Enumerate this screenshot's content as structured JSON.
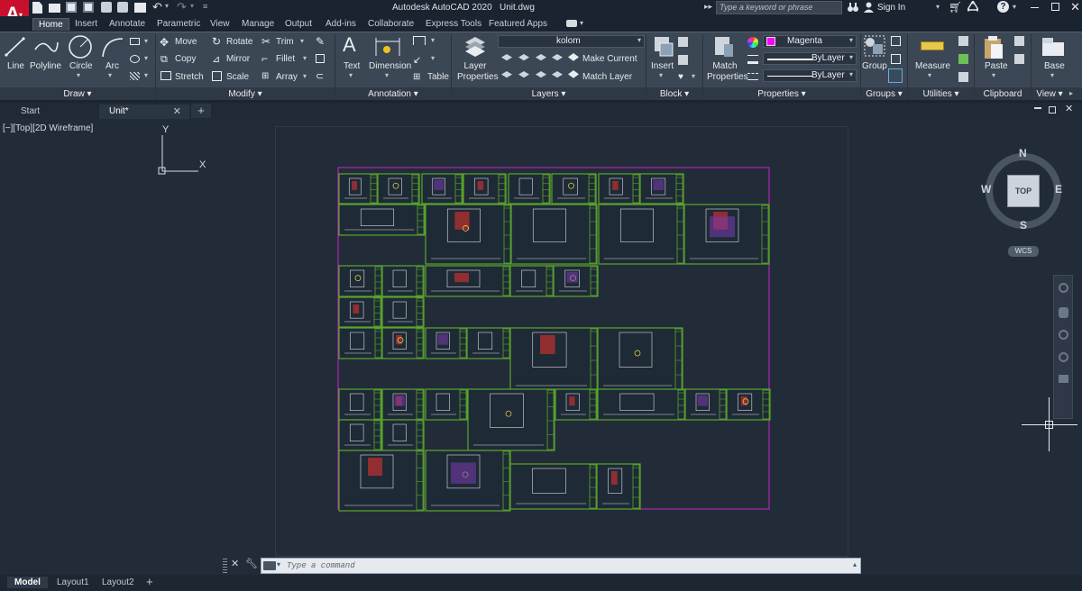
{
  "app": {
    "title": "Autodesk AutoCAD 2020",
    "file": "Unit.dwg",
    "logo_letter": "A",
    "search_placeholder": "Type a keyword or phrase",
    "signin": "Sign In"
  },
  "ribbon_tabs": [
    "Home",
    "Insert",
    "Annotate",
    "Parametric",
    "View",
    "Manage",
    "Output",
    "Add-ins",
    "Collaborate",
    "Express Tools",
    "Featured Apps"
  ],
  "draw": {
    "line": "Line",
    "polyline": "Polyline",
    "circle": "Circle",
    "arc": "Arc",
    "label": "Draw"
  },
  "modify": {
    "move": "Move",
    "rotate": "Rotate",
    "trim": "Trim",
    "copy": "Copy",
    "mirror": "Mirror",
    "fillet": "Fillet",
    "stretch": "Stretch",
    "scale": "Scale",
    "array": "Array",
    "label": "Modify"
  },
  "annotation": {
    "text": "Text",
    "dimension": "Dimension",
    "table": "Table",
    "label": "Annotation"
  },
  "layers": {
    "layer_properties": "Layer Properties",
    "current_layer": "kolom",
    "make_current": "Make Current",
    "match_layer": "Match Layer",
    "label": "Layers",
    "color": "#ff00ff"
  },
  "block": {
    "insert": "Insert",
    "label": "Block"
  },
  "properties": {
    "match": "Match Properties",
    "color_name": "Magenta",
    "linetype": "ByLayer",
    "lineweight": "ByLayer",
    "label": "Properties",
    "color": "#ff00ff"
  },
  "groups": {
    "group": "Group",
    "label": "Groups"
  },
  "utilities": {
    "measure": "Measure",
    "label": "Utilities"
  },
  "clipboard": {
    "paste": "Paste",
    "label": "Clipboard"
  },
  "view": {
    "base": "Base",
    "label": "View"
  },
  "doc_tabs": {
    "start": "Start",
    "unit": "Unit*"
  },
  "viewport": {
    "label": "[−][Top][2D Wireframe]",
    "ucs_x": "X",
    "ucs_y": "Y"
  },
  "viewcube": {
    "n": "N",
    "s": "S",
    "e": "E",
    "w": "W",
    "top": "TOP",
    "wcs": "WCS"
  },
  "command": {
    "placeholder": "Type  a  command"
  },
  "layout_tabs": [
    "Model",
    "Layout1",
    "Layout2"
  ],
  "colors": {
    "sheet_green": "#5aa52c",
    "border_magenta": "#c824c8",
    "bg": "#222c39"
  }
}
